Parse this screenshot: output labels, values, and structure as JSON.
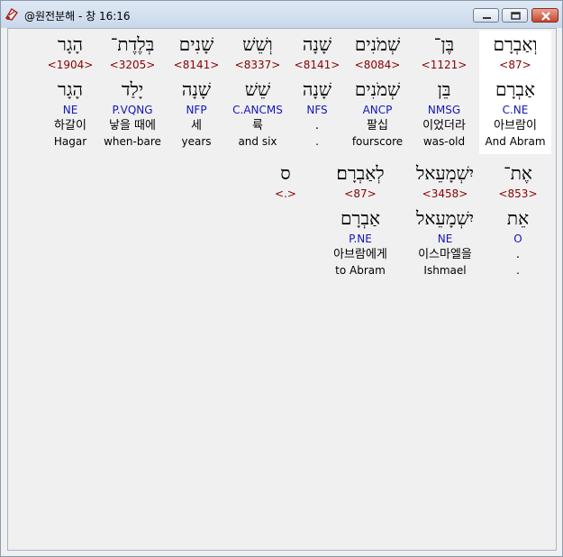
{
  "window": {
    "title": "@원전분해 - 창 16:16"
  },
  "verse": {
    "row1": [
      {
        "heb": "וְאַבְרָם",
        "strong": "<87>",
        "lemma": "אַבְרָם",
        "morph": "C.NE",
        "kor": "아브람이",
        "eng": "And Abram"
      },
      {
        "heb": "בֶּן־",
        "strong": "<1121>",
        "lemma": "בֵּן",
        "morph": "NMSG",
        "kor": "이었더라",
        "eng": "was-old"
      },
      {
        "heb": "שְׁמֹנִים",
        "strong": "<8084>",
        "lemma": "שְׁמֹנִים",
        "morph": "ANCP",
        "kor": "팔십",
        "eng": "fourscore"
      },
      {
        "heb": "שָׁנָה",
        "strong": "<8141>",
        "lemma": "שָׁנָה",
        "morph": "NFS",
        "kor": ".",
        "eng": "."
      },
      {
        "heb": "וְשֵׁשׁ",
        "strong": "<8337>",
        "lemma": "שֵׁשׁ",
        "morph": "C.ANCMS",
        "kor": "륙",
        "eng": "and six"
      },
      {
        "heb": "שָׁנִים",
        "strong": "<8141>",
        "lemma": "שָׁנָה",
        "morph": "NFP",
        "kor": "세",
        "eng": "years"
      },
      {
        "heb": "בְּלֶדֶת־",
        "strong": "<3205>",
        "lemma": "יָלַד",
        "morph": "P.VQNG",
        "kor": "낳을 때에",
        "eng": "when-bare"
      },
      {
        "heb": "הָגָר",
        "strong": "<1904>",
        "lemma": "הָגָר",
        "morph": "NE",
        "kor": "하갈이",
        "eng": "Hagar"
      }
    ],
    "row2": [
      {
        "heb": "אֶת־",
        "strong": "<853>",
        "lemma": "אֵת",
        "morph": "O",
        "kor": ".",
        "eng": "."
      },
      {
        "heb": "יִשְׁמָעֵאל",
        "strong": "<3458>",
        "lemma": "יִשְׁמָעֵאל",
        "morph": "NE",
        "kor": "이스마엘을",
        "eng": "Ishmael"
      },
      {
        "heb": "לְאַבְרָם׃",
        "strong": "<87>",
        "lemma": "אַבְרָם",
        "morph": "P.NE",
        "kor": "아브람에게",
        "eng": "to Abram"
      },
      {
        "heb": "ס",
        "strong": "<.>",
        "lemma": "",
        "morph": "",
        "kor": "",
        "eng": ""
      }
    ]
  }
}
